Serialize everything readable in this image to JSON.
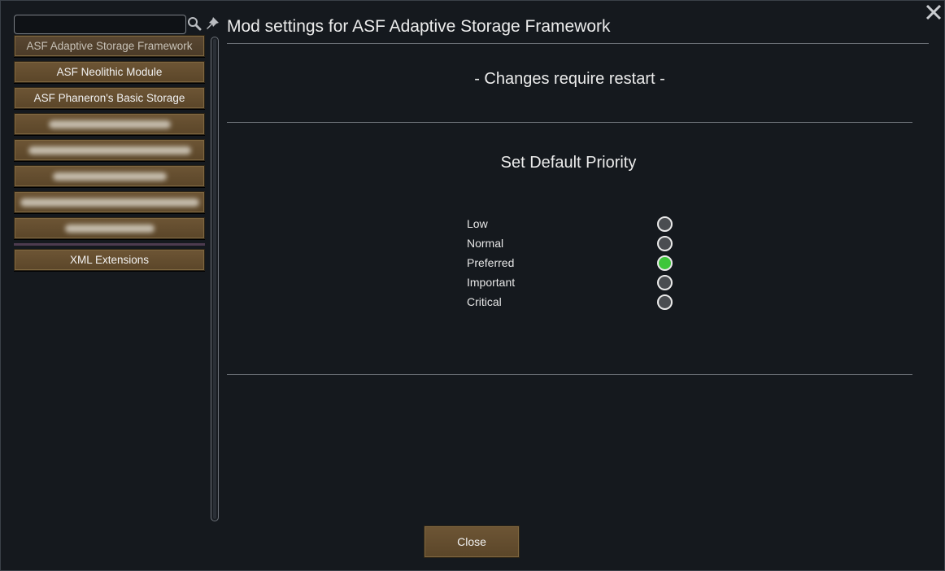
{
  "header": {
    "title": "Mod settings for ASF Adaptive Storage Framework",
    "close_icon": "close-x-icon"
  },
  "sidebar": {
    "search": {
      "value": "",
      "placeholder": ""
    },
    "icons": {
      "search": "search-icon",
      "pin": "pin-icon"
    },
    "mods": [
      {
        "label": "ASF Adaptive Storage Framework",
        "selected": true
      },
      {
        "label": "ASF Neolithic Module"
      },
      {
        "label": "ASF Phaneron's Basic Storage"
      }
    ],
    "extra": [
      {
        "label": "XML Extensions"
      }
    ]
  },
  "settings": {
    "restart_note": "- Changes require restart -",
    "section_title": "Set Default Priority",
    "priorities": [
      {
        "label": "Low",
        "checked": false
      },
      {
        "label": "Normal",
        "checked": false
      },
      {
        "label": "Preferred",
        "checked": true
      },
      {
        "label": "Important",
        "checked": false
      },
      {
        "label": "Critical",
        "checked": false
      }
    ]
  },
  "footer": {
    "close_label": "Close"
  },
  "colors": {
    "accent_selected": "#3ec63a",
    "button_brown": "#6d5535"
  }
}
